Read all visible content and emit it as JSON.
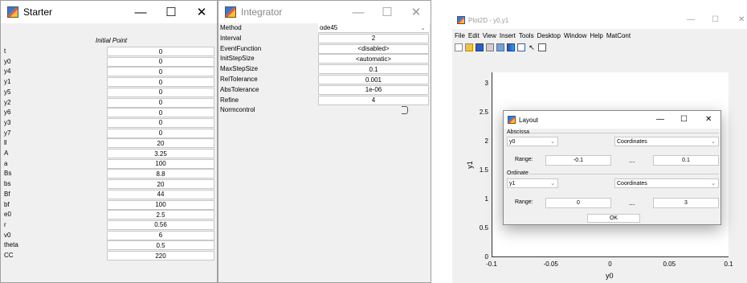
{
  "starter": {
    "title": "Starter",
    "header": "Initial Point",
    "rows": [
      {
        "label": "t",
        "value": "0"
      },
      {
        "label": "y0",
        "value": "0"
      },
      {
        "label": "y4",
        "value": "0"
      },
      {
        "label": "y1",
        "value": "0"
      },
      {
        "label": "y5",
        "value": "0"
      },
      {
        "label": "y2",
        "value": "0"
      },
      {
        "label": "y6",
        "value": "0"
      },
      {
        "label": "y3",
        "value": "0"
      },
      {
        "label": "y7",
        "value": "0"
      },
      {
        "label": "ll",
        "value": "20"
      },
      {
        "label": "A",
        "value": "3.25"
      },
      {
        "label": "a",
        "value": "100"
      },
      {
        "label": "Bs",
        "value": "8.8"
      },
      {
        "label": "bs",
        "value": "20"
      },
      {
        "label": "Bf",
        "value": "44"
      },
      {
        "label": "bf",
        "value": "100"
      },
      {
        "label": "e0",
        "value": "2.5"
      },
      {
        "label": "r",
        "value": "0.56"
      },
      {
        "label": "v0",
        "value": "6"
      },
      {
        "label": "theta",
        "value": "0.5"
      },
      {
        "label": "CC",
        "value": "220"
      }
    ]
  },
  "integrator": {
    "title": "Integrator",
    "rows": [
      {
        "label": "Method",
        "value": "ode45"
      },
      {
        "label": "Interval",
        "value": "2"
      },
      {
        "label": "EventFunction",
        "value": "<disabled>"
      },
      {
        "label": "InitStepSize",
        "value": "<automatic>"
      },
      {
        "label": "MaxStepSize",
        "value": "0.1"
      },
      {
        "label": "RelTolerance",
        "value": "0.001"
      },
      {
        "label": "AbsTolerance",
        "value": "1e-06"
      },
      {
        "label": "Refine",
        "value": "4"
      },
      {
        "label": "Normcontrol",
        "value": ""
      }
    ]
  },
  "plot": {
    "title": "Plot2D - y0,y1",
    "menu": [
      "File",
      "Edit",
      "View",
      "Insert",
      "Tools",
      "Desktop",
      "Window",
      "Help",
      "MatCont"
    ],
    "xlabel": "y0",
    "ylabel": "y1",
    "xticks": [
      "-0.1",
      "-0.05",
      "0",
      "0.05",
      "0.1"
    ],
    "yticks": [
      "0",
      "0.5",
      "1",
      "1.5",
      "2",
      "2.5",
      "3"
    ]
  },
  "layout": {
    "title": "Layout",
    "abscissa_label": "Abscissa",
    "abscissa_var": "y0",
    "abscissa_coord": "Coordinates",
    "abscissa_range_label": "Range:",
    "abscissa_min": "-0.1",
    "abscissa_dots": "...",
    "abscissa_max": "0.1",
    "ordinate_label": "Ordinate",
    "ordinate_var": "y1",
    "ordinate_coord": "Coordinates",
    "ordinate_range_label": "Range:",
    "ordinate_min": "0",
    "ordinate_dots": "...",
    "ordinate_max": "3",
    "ok_label": "OK"
  },
  "icons": {
    "minimize": "—",
    "maximize": "☐",
    "close": "✕",
    "chevron": "⌄"
  }
}
